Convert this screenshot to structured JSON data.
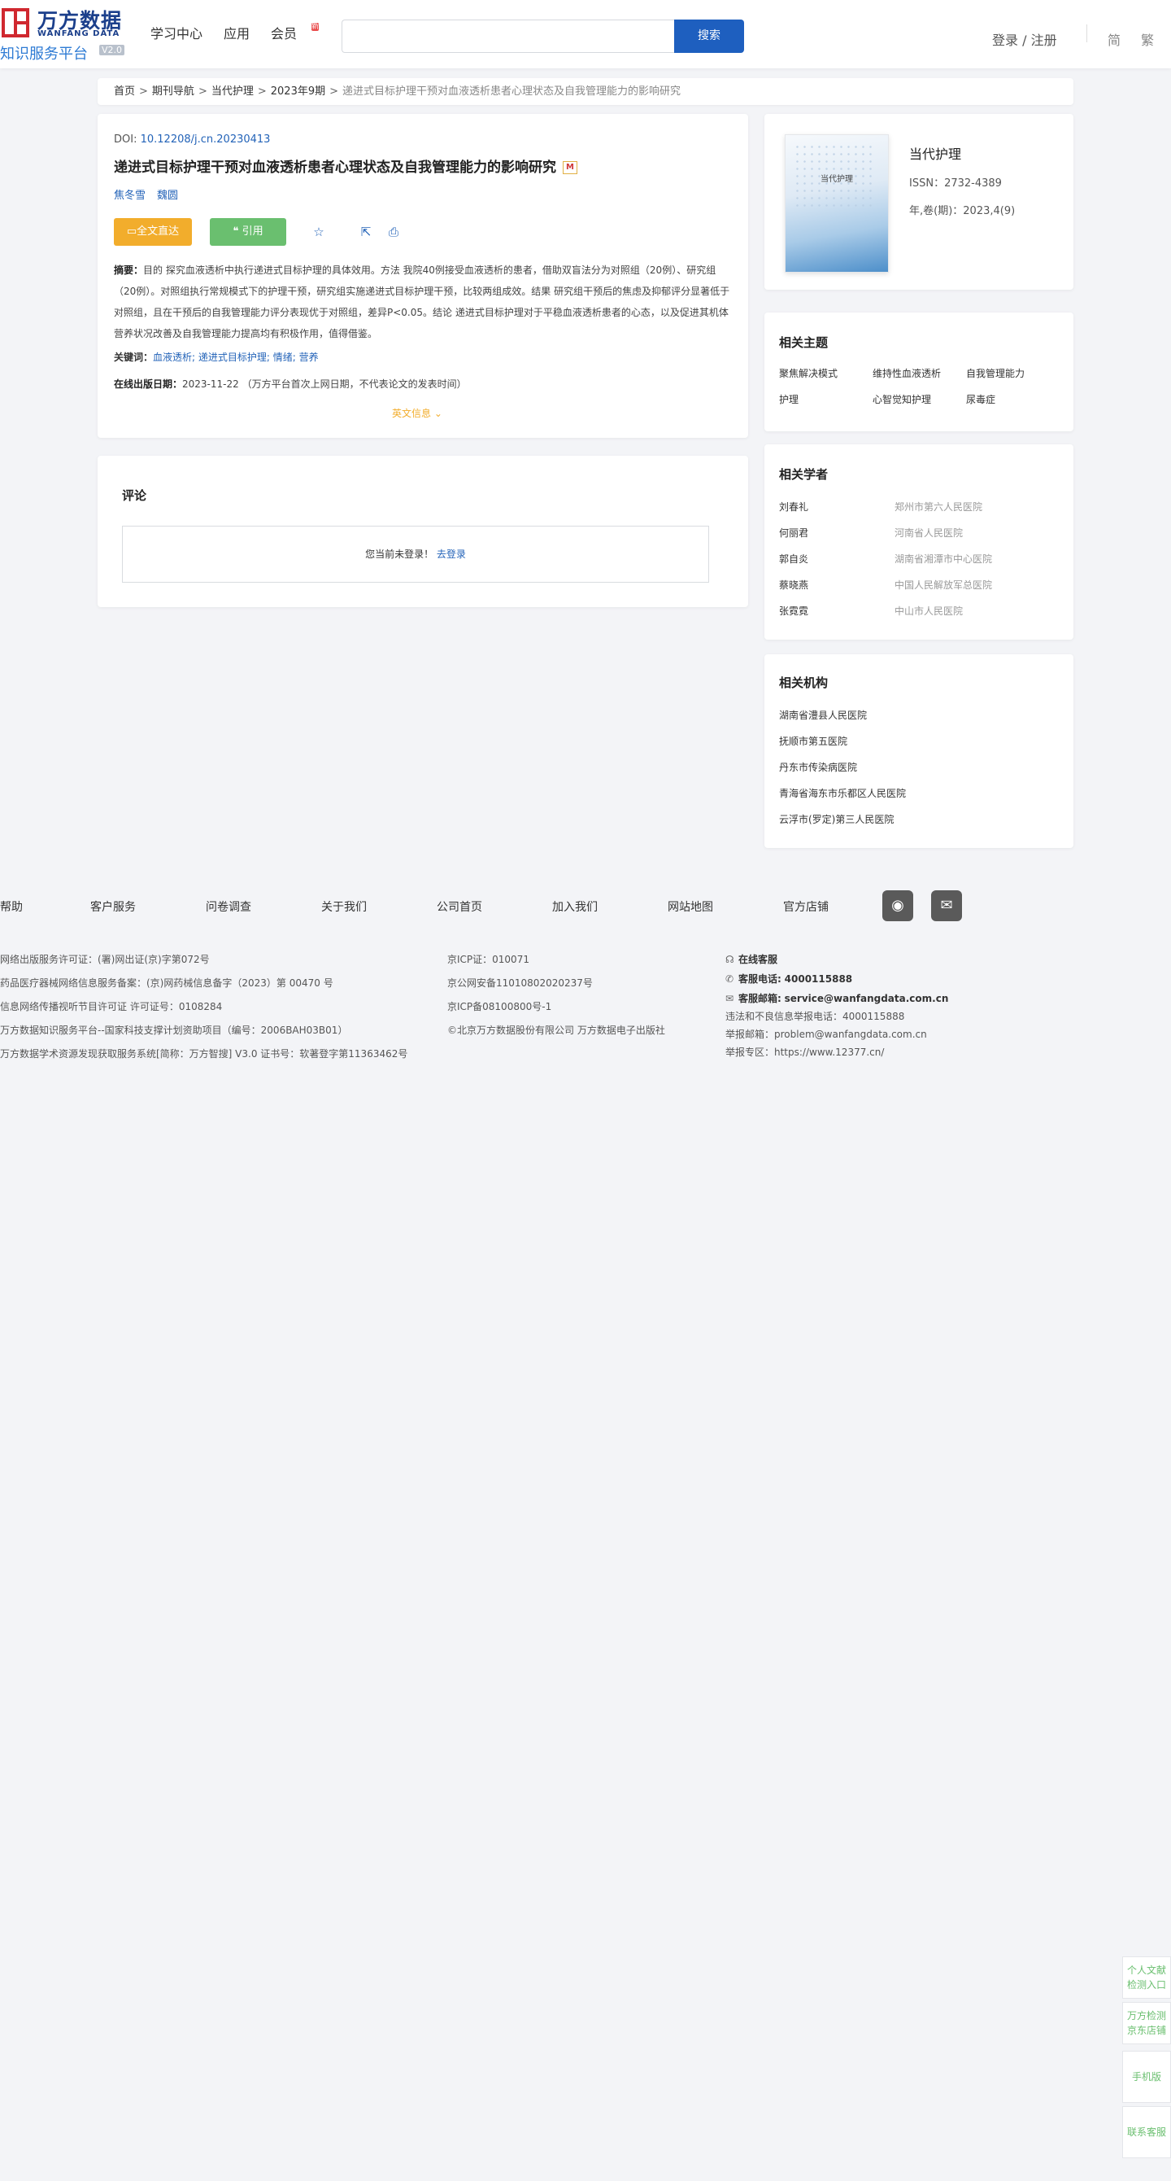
{
  "header": {
    "logo_cn": "万方数据",
    "logo_en": "WANFANG DATA",
    "logo_sub": "知识服务平台",
    "logo_ver": "V2.0",
    "nav": [
      "学习中心",
      "应用",
      "会员"
    ],
    "nav_badge": "新",
    "search_placeholder": "",
    "search_button": "搜索",
    "login": "登录 / 注册",
    "lang_simplified": "简",
    "lang_traditional": "繁"
  },
  "breadcrumb": {
    "items": [
      "首页",
      "期刊导航",
      "当代护理",
      "2023年9期"
    ],
    "current": "递进式目标护理干预对血液透析患者心理状态及自我管理能力的影响研究",
    "sep": ">"
  },
  "article": {
    "doi_label": "DOI:",
    "doi": "10.12208/j.cn.20230413",
    "title": "递进式目标护理干预对血液透析患者心理状态及自我管理能力的影响研究",
    "title_badge": "M",
    "authors": [
      "焦冬雪",
      "魏圆"
    ],
    "btn_fulltext": "全文直达",
    "btn_cite": "引用",
    "abstract_label": "摘要：",
    "abstract": "目的 探究血液透析中执行递进式目标护理的具体效用。方法 我院40例接受血液透析的患者，借助双盲法分为对照组（20例）、研究组（20例）。对照组执行常规模式下的护理干预，研究组实施递进式目标护理干预，比较两组成效。结果 研究组干预后的焦虑及抑郁评分显著低于对照组，且在干预后的自我管理能力评分表现优于对照组，差异P<0.05。结论 递进式目标护理对于平稳血液透析患者的心态，以及促进其机体营养状况改善及自我管理能力提高均有积极作用，值得借鉴。",
    "keywords_label": "关键词：",
    "keywords": "血液透析; 递进式目标护理; 情绪; 营养",
    "pubdate_label": "在线出版日期：",
    "pubdate": "2023-11-22",
    "pubdate_note": "（万方平台首次上网日期，不代表论文的发表时间）",
    "en_info": "英文信息"
  },
  "comment": {
    "title": "评论",
    "not_logged": "您当前未登录！",
    "login_link": "去登录"
  },
  "journal": {
    "cover_title": "当代护理",
    "name": "当代护理",
    "issn": "ISSN：2732-4389",
    "vol": "年,卷(期)：2023,4(9)"
  },
  "topics": {
    "title": "相关主题",
    "items": [
      "聚焦解决模式",
      "维持性血液透析",
      "自我管理能力",
      "护理",
      "心智觉知护理",
      "尿毒症"
    ]
  },
  "scholars": {
    "title": "相关学者",
    "items": [
      {
        "name": "刘春礼",
        "org": "郑州市第六人民医院"
      },
      {
        "name": "何丽君",
        "org": "河南省人民医院"
      },
      {
        "name": "郭自炎",
        "org": "湖南省湘潭市中心医院"
      },
      {
        "name": "蔡晓燕",
        "org": "中国人民解放军总医院"
      },
      {
        "name": "张霓霓",
        "org": "中山市人民医院"
      }
    ]
  },
  "institutions": {
    "title": "相关机构",
    "items": [
      "湖南省澧县人民医院",
      "抚顺市第五医院",
      "丹东市传染病医院",
      "青海省海东市乐都区人民医院",
      "云浮市(罗定)第三人民医院"
    ]
  },
  "footer": {
    "links": [
      "帮助",
      "客户服务",
      "问卷调查",
      "关于我们",
      "公司首页",
      "加入我们",
      "网站地图",
      "官方店铺"
    ],
    "left": [
      "网络出版服务许可证：(署)网出证(京)字第072号",
      "药品医疗器械网络信息服务备案：(京)网药械信息备字（2023）第 00470 号",
      "信息网络传播视听节目许可证 许可证号：0108284",
      "万方数据知识服务平台--国家科技支撑计划资助项目（编号：2006BAH03B01）",
      "万方数据学术资源发现获取服务系统[简称：万方智搜] V3.0 证书号：软著登字第11363462号"
    ],
    "mid": [
      "京ICP证：010071",
      "京公网安备11010802020237号",
      "京ICP备08100800号-1",
      "©北京万方数据股份有限公司 万方数据电子出版社"
    ],
    "online_service": "在线客服",
    "phone_label": "客服电话:",
    "phone": "4000115888",
    "email_label": "客服邮箱:",
    "email": "service@wanfangdata.com.cn",
    "report_phone": "违法和不良信息举报电话：4000115888",
    "report_email": "举报邮箱：problem@wanfangdata.com.cn",
    "report_zone": "举报专区：https://www.12377.cn/"
  },
  "floats": [
    "个人文献检测入口",
    "万方检测京东店铺",
    "手机版",
    "联系客服"
  ]
}
